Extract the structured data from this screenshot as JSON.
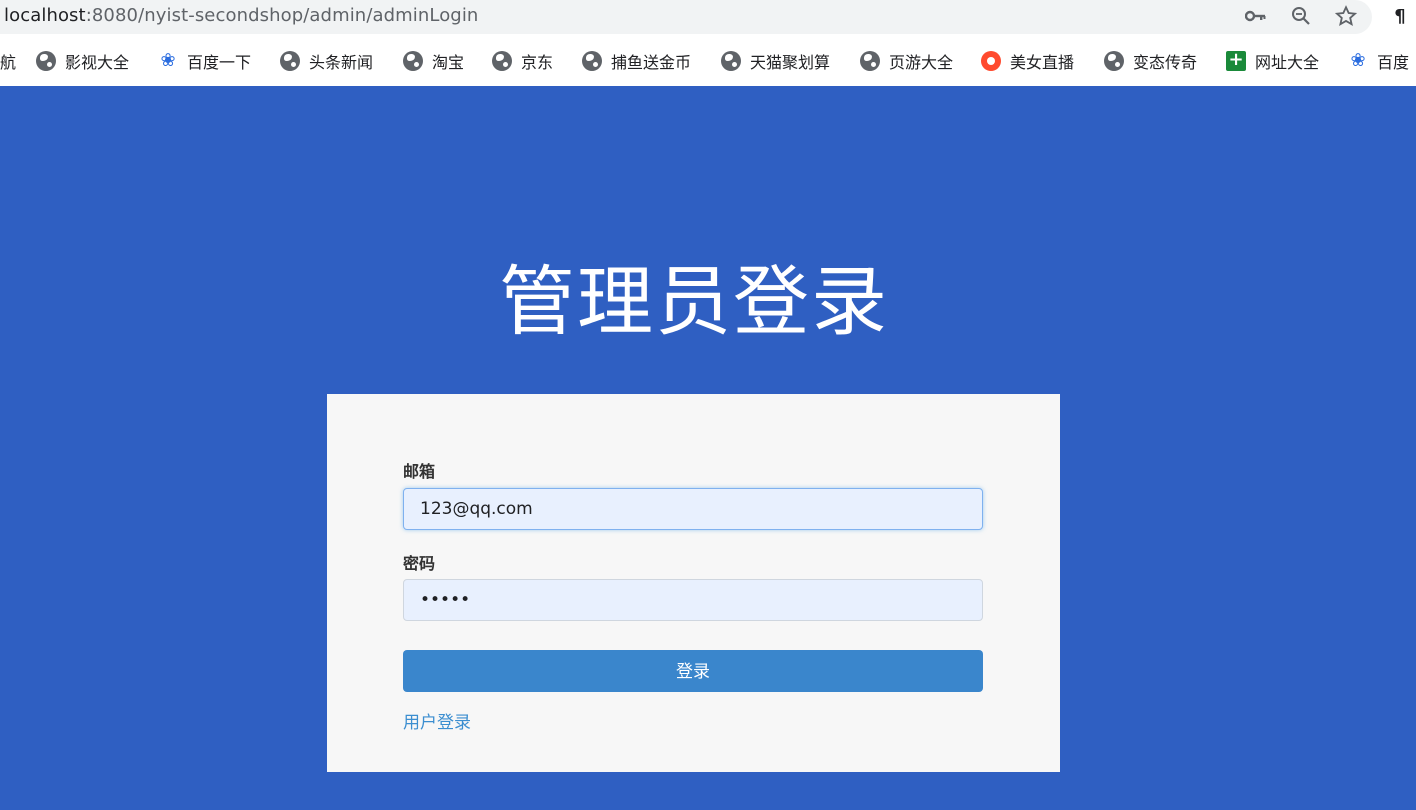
{
  "browser": {
    "url_host": "localhost",
    "url_rest": ":8080/nyist-secondshop/admin/adminLogin",
    "toolbar_icons": [
      "key-icon",
      "zoom-icon",
      "star-icon",
      "pilcrow-icon"
    ],
    "bookmarks": [
      {
        "label": "航",
        "icon": "none"
      },
      {
        "label": "影视大全",
        "icon": "globe-icon"
      },
      {
        "label": "百度一下",
        "icon": "paw-icon"
      },
      {
        "label": "头条新闻",
        "icon": "globe-icon"
      },
      {
        "label": "淘宝",
        "icon": "globe-icon"
      },
      {
        "label": "京东",
        "icon": "globe-icon"
      },
      {
        "label": "捕鱼送金币",
        "icon": "globe-icon"
      },
      {
        "label": "天猫聚划算",
        "icon": "globe-icon"
      },
      {
        "label": "页游大全",
        "icon": "globe-icon"
      },
      {
        "label": "美女直播",
        "icon": "live-icon"
      },
      {
        "label": "变态传奇",
        "icon": "globe-icon"
      },
      {
        "label": "网址大全",
        "icon": "grid-icon"
      },
      {
        "label": "百度",
        "icon": "paw-icon"
      }
    ]
  },
  "page": {
    "title": "管理员登录",
    "email_label": "邮箱",
    "email_value": "123@qq.com",
    "password_label": "密码",
    "password_value": "•••••",
    "login_button": "登录",
    "user_login_link": "用户登录",
    "colors": {
      "background": "#2f5fc2",
      "card": "#f7f7f7",
      "button": "#3a86cc",
      "link": "#3b8ed0"
    }
  }
}
